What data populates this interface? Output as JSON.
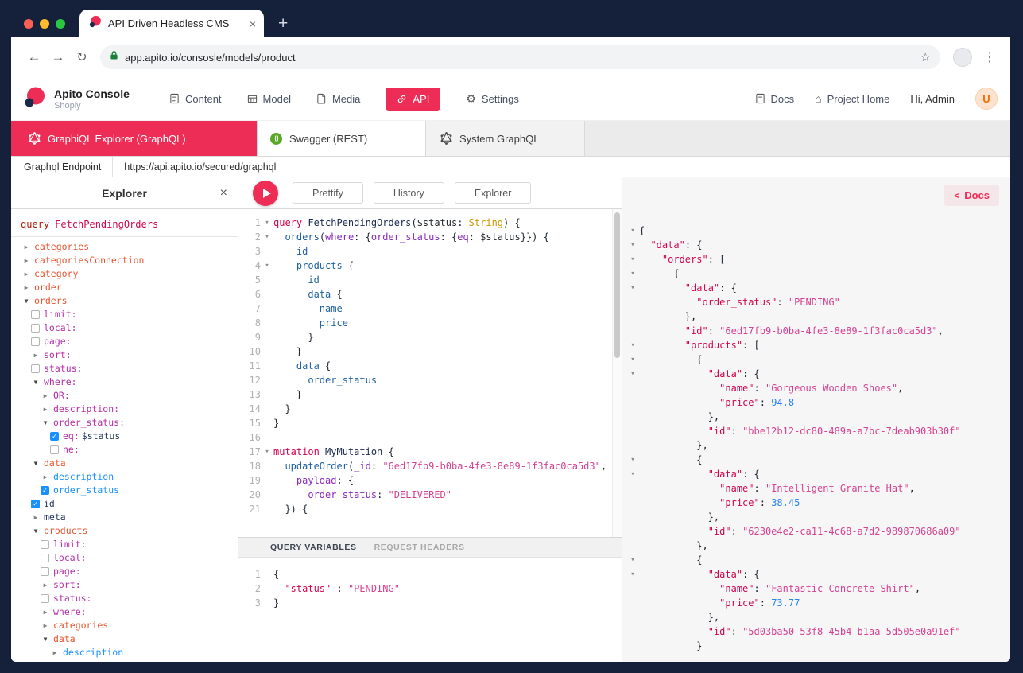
{
  "colors": {
    "accent": "#ed2d55",
    "frame": "#15213b",
    "checkbox_on": "#1890ff"
  },
  "icons": {
    "back": "←",
    "forward": "→",
    "reload": "↻",
    "bookmark": "☆",
    "menu": "⋮",
    "new_tab": "+",
    "tab_close": "×",
    "panel_close": "×",
    "gear": "⚙",
    "home": "⌂",
    "collapsed": "▶",
    "expanded": "▼",
    "checked": "✓",
    "fold": "▾"
  },
  "browser": {
    "tab_title": "API Driven Headless CMS",
    "url": "app.apito.io/consosle/models/product"
  },
  "header": {
    "brand": {
      "title": "Apito Console",
      "subtitle": "Shoply"
    },
    "nav": [
      {
        "label": "Content"
      },
      {
        "label": "Model"
      },
      {
        "label": "Media"
      },
      {
        "label": "API"
      },
      {
        "label": "Settings"
      }
    ],
    "right": {
      "docs": "Docs",
      "project_home": "Project Home",
      "greeting": "Hi, Admin",
      "avatar_initial": "U"
    }
  },
  "api_tabs": [
    {
      "label": "GraphiQL Explorer (GraphQL)",
      "active": true
    },
    {
      "label": "Swagger (REST)",
      "active": false
    },
    {
      "label": "System GraphQL",
      "active": false
    }
  ],
  "endpoint": {
    "label": "Graphql Endpoint",
    "url": "https://api.apito.io/secured/graphql"
  },
  "toolbar": {
    "prettify": "Prettify",
    "history": "History",
    "explorer": "Explorer"
  },
  "docs_button": {
    "chevron": "<",
    "label": "Docs"
  },
  "explorer_panel": {
    "title": "Explorer",
    "operation_keyword": "query",
    "operation_name": "FetchPendingOrders",
    "items": [
      {
        "indent": 0,
        "marker": "collapsed",
        "color": "field",
        "label": "categories"
      },
      {
        "indent": 0,
        "marker": "collapsed",
        "color": "field",
        "label": "categoriesConnection"
      },
      {
        "indent": 0,
        "marker": "collapsed",
        "color": "field",
        "label": "category"
      },
      {
        "indent": 0,
        "marker": "collapsed",
        "color": "field",
        "label": "order"
      },
      {
        "indent": 0,
        "marker": "expanded",
        "color": "field",
        "label": "orders"
      },
      {
        "indent": 1,
        "marker": "unchecked",
        "color": "arg",
        "label": "limit:"
      },
      {
        "indent": 1,
        "marker": "unchecked",
        "color": "arg",
        "label": "local:"
      },
      {
        "indent": 1,
        "marker": "unchecked",
        "color": "arg",
        "label": "page:"
      },
      {
        "indent": 1,
        "marker": "collapsed",
        "color": "arg",
        "label": "sort:"
      },
      {
        "indent": 1,
        "marker": "unchecked",
        "color": "arg",
        "label": "status:"
      },
      {
        "indent": 1,
        "marker": "expanded",
        "color": "arg",
        "label": "where:"
      },
      {
        "indent": 2,
        "marker": "collapsed",
        "color": "arg",
        "label": "OR:"
      },
      {
        "indent": 2,
        "marker": "collapsed",
        "color": "arg",
        "label": "description:"
      },
      {
        "indent": 2,
        "marker": "expanded",
        "color": "arg",
        "label": "order_status:"
      },
      {
        "indent": 3,
        "marker": "checked",
        "color": "arg",
        "label": "eq:",
        "suffix": "$status"
      },
      {
        "indent": 3,
        "marker": "unchecked",
        "color": "arg",
        "label": "ne:"
      },
      {
        "indent": 1,
        "marker": "expanded",
        "color": "field",
        "label": "data"
      },
      {
        "indent": 2,
        "marker": "collapsed",
        "color": "leaf",
        "label": "description"
      },
      {
        "indent": 2,
        "marker": "checked",
        "color": "leaf",
        "label": "order_status"
      },
      {
        "indent": 1,
        "marker": "checked",
        "color": "plain",
        "label": "id"
      },
      {
        "indent": 1,
        "marker": "collapsed",
        "color": "plain",
        "label": "meta"
      },
      {
        "indent": 1,
        "marker": "expanded",
        "color": "field",
        "label": "products"
      },
      {
        "indent": 2,
        "marker": "unchecked",
        "color": "arg",
        "label": "limit:"
      },
      {
        "indent": 2,
        "marker": "unchecked",
        "color": "arg",
        "label": "local:"
      },
      {
        "indent": 2,
        "marker": "unchecked",
        "color": "arg",
        "label": "page:"
      },
      {
        "indent": 2,
        "marker": "collapsed",
        "color": "arg",
        "label": "sort:"
      },
      {
        "indent": 2,
        "marker": "unchecked",
        "color": "arg",
        "label": "status:"
      },
      {
        "indent": 2,
        "marker": "collapsed",
        "color": "arg",
        "label": "where:"
      },
      {
        "indent": 2,
        "marker": "collapsed",
        "color": "field",
        "label": "categories"
      },
      {
        "indent": 2,
        "marker": "expanded",
        "color": "field",
        "label": "data"
      },
      {
        "indent": 3,
        "marker": "collapsed",
        "color": "leaf",
        "label": "description"
      }
    ]
  },
  "editor": {
    "lines": [
      {
        "n": 1,
        "f": true,
        "t": [
          [
            "kw",
            "query"
          ],
          [
            "pl",
            " "
          ],
          [
            "def",
            "FetchPendingOrders"
          ],
          [
            "pl",
            "("
          ],
          [
            "var",
            "$status"
          ],
          [
            "pl",
            ": "
          ],
          [
            "atom",
            "String"
          ],
          [
            "pl",
            ") {"
          ]
        ]
      },
      {
        "n": 2,
        "f": true,
        "t": [
          [
            "pl",
            "  "
          ],
          [
            "prop",
            "orders"
          ],
          [
            "pl",
            "("
          ],
          [
            "attr",
            "where"
          ],
          [
            "pl",
            ": {"
          ],
          [
            "attr",
            "order_status"
          ],
          [
            "pl",
            ": {"
          ],
          [
            "attr",
            "eq"
          ],
          [
            "pl",
            ": "
          ],
          [
            "var",
            "$status"
          ],
          [
            "pl",
            "}}) {"
          ]
        ]
      },
      {
        "n": 3,
        "t": [
          [
            "pl",
            "    "
          ],
          [
            "prop",
            "id"
          ]
        ]
      },
      {
        "n": 4,
        "f": true,
        "t": [
          [
            "pl",
            "    "
          ],
          [
            "prop",
            "products"
          ],
          [
            "pl",
            " {"
          ]
        ]
      },
      {
        "n": 5,
        "t": [
          [
            "pl",
            "      "
          ],
          [
            "prop",
            "id"
          ]
        ]
      },
      {
        "n": 6,
        "t": [
          [
            "pl",
            "      "
          ],
          [
            "prop",
            "data"
          ],
          [
            "pl",
            " {"
          ]
        ]
      },
      {
        "n": 7,
        "t": [
          [
            "pl",
            "        "
          ],
          [
            "prop",
            "name"
          ]
        ]
      },
      {
        "n": 8,
        "t": [
          [
            "pl",
            "        "
          ],
          [
            "prop",
            "price"
          ]
        ]
      },
      {
        "n": 9,
        "t": [
          [
            "pl",
            "      }"
          ]
        ]
      },
      {
        "n": 10,
        "t": [
          [
            "pl",
            "    }"
          ]
        ]
      },
      {
        "n": 11,
        "t": [
          [
            "pl",
            "    "
          ],
          [
            "prop",
            "data"
          ],
          [
            "pl",
            " {"
          ]
        ]
      },
      {
        "n": 12,
        "t": [
          [
            "pl",
            "      "
          ],
          [
            "prop",
            "order_status"
          ]
        ]
      },
      {
        "n": 13,
        "t": [
          [
            "pl",
            "    }"
          ]
        ]
      },
      {
        "n": 14,
        "t": [
          [
            "pl",
            "  }"
          ]
        ]
      },
      {
        "n": 15,
        "t": [
          [
            "pl",
            "}"
          ]
        ]
      },
      {
        "n": 16,
        "t": []
      },
      {
        "n": 17,
        "f": true,
        "t": [
          [
            "kw",
            "mutation"
          ],
          [
            "pl",
            " "
          ],
          [
            "def",
            "MyMutation"
          ],
          [
            "pl",
            " {"
          ]
        ]
      },
      {
        "n": 18,
        "t": [
          [
            "pl",
            "  "
          ],
          [
            "prop",
            "updateOrder"
          ],
          [
            "pl",
            "("
          ],
          [
            "attr",
            "_id"
          ],
          [
            "pl",
            ": "
          ],
          [
            "str",
            "\"6ed17fb9-b0ba-4fe3-8e89-1f3fac0ca5d3\""
          ],
          [
            "pl",
            ","
          ]
        ]
      },
      {
        "n": 19,
        "t": [
          [
            "pl",
            "    "
          ],
          [
            "attr",
            "payload"
          ],
          [
            "pl",
            ": {"
          ]
        ]
      },
      {
        "n": 20,
        "t": [
          [
            "pl",
            "      "
          ],
          [
            "attr",
            "order_status"
          ],
          [
            "pl",
            ": "
          ],
          [
            "str",
            "\"DELIVERED\""
          ]
        ]
      },
      {
        "n": 21,
        "t": [
          [
            "pl",
            "  }) {"
          ]
        ]
      }
    ]
  },
  "variables": {
    "tab_active": "QUERY VARIABLES",
    "tab_inactive": "REQUEST HEADERS",
    "lines": [
      {
        "n": 1,
        "t": [
          [
            "pl",
            "{"
          ]
        ]
      },
      {
        "n": 2,
        "t": [
          [
            "pl",
            "  "
          ],
          [
            "key",
            "\"status\""
          ],
          [
            "pl",
            " : "
          ],
          [
            "str",
            "\"PENDING\""
          ]
        ]
      },
      {
        "n": 3,
        "t": [
          [
            "pl",
            "}"
          ]
        ]
      }
    ]
  },
  "result": {
    "lines": [
      {
        "f": true,
        "t": [
          [
            "pl",
            "{"
          ]
        ]
      },
      {
        "f": true,
        "t": [
          [
            "pl",
            "  "
          ],
          [
            "key",
            "\"data\""
          ],
          [
            "pl",
            ": {"
          ]
        ]
      },
      {
        "f": true,
        "t": [
          [
            "pl",
            "    "
          ],
          [
            "key",
            "\"orders\""
          ],
          [
            "pl",
            ": ["
          ]
        ]
      },
      {
        "f": true,
        "t": [
          [
            "pl",
            "      {"
          ]
        ]
      },
      {
        "f": true,
        "t": [
          [
            "pl",
            "        "
          ],
          [
            "key",
            "\"data\""
          ],
          [
            "pl",
            ": {"
          ]
        ]
      },
      {
        "t": [
          [
            "pl",
            "          "
          ],
          [
            "key",
            "\"order_status\""
          ],
          [
            "pl",
            ": "
          ],
          [
            "str",
            "\"PENDING\""
          ]
        ]
      },
      {
        "t": [
          [
            "pl",
            "        },"
          ]
        ]
      },
      {
        "t": [
          [
            "pl",
            "        "
          ],
          [
            "key",
            "\"id\""
          ],
          [
            "pl",
            ": "
          ],
          [
            "str",
            "\"6ed17fb9-b0ba-4fe3-8e89-1f3fac0ca5d3\""
          ],
          [
            "pl",
            ","
          ]
        ]
      },
      {
        "f": true,
        "t": [
          [
            "pl",
            "        "
          ],
          [
            "key",
            "\"products\""
          ],
          [
            "pl",
            ": ["
          ]
        ]
      },
      {
        "f": true,
        "t": [
          [
            "pl",
            "          {"
          ]
        ]
      },
      {
        "f": true,
        "t": [
          [
            "pl",
            "            "
          ],
          [
            "key",
            "\"data\""
          ],
          [
            "pl",
            ": {"
          ]
        ]
      },
      {
        "t": [
          [
            "pl",
            "              "
          ],
          [
            "key",
            "\"name\""
          ],
          [
            "pl",
            ": "
          ],
          [
            "str",
            "\"Gorgeous Wooden Shoes\""
          ],
          [
            "pl",
            ","
          ]
        ]
      },
      {
        "t": [
          [
            "pl",
            "              "
          ],
          [
            "key",
            "\"price\""
          ],
          [
            "pl",
            ": "
          ],
          [
            "num",
            "94.8"
          ]
        ]
      },
      {
        "t": [
          [
            "pl",
            "            },"
          ]
        ]
      },
      {
        "t": [
          [
            "pl",
            "            "
          ],
          [
            "key",
            "\"id\""
          ],
          [
            "pl",
            ": "
          ],
          [
            "str",
            "\"bbe12b12-dc80-489a-a7bc-7deab903b30f\""
          ]
        ]
      },
      {
        "t": [
          [
            "pl",
            "          },"
          ]
        ]
      },
      {
        "f": true,
        "t": [
          [
            "pl",
            "          {"
          ]
        ]
      },
      {
        "f": true,
        "t": [
          [
            "pl",
            "            "
          ],
          [
            "key",
            "\"data\""
          ],
          [
            "pl",
            ": {"
          ]
        ]
      },
      {
        "t": [
          [
            "pl",
            "              "
          ],
          [
            "key",
            "\"name\""
          ],
          [
            "pl",
            ": "
          ],
          [
            "str",
            "\"Intelligent Granite Hat\""
          ],
          [
            "pl",
            ","
          ]
        ]
      },
      {
        "t": [
          [
            "pl",
            "              "
          ],
          [
            "key",
            "\"price\""
          ],
          [
            "pl",
            ": "
          ],
          [
            "num",
            "38.45"
          ]
        ]
      },
      {
        "t": [
          [
            "pl",
            "            },"
          ]
        ]
      },
      {
        "t": [
          [
            "pl",
            "            "
          ],
          [
            "key",
            "\"id\""
          ],
          [
            "pl",
            ": "
          ],
          [
            "str",
            "\"6230e4e2-ca11-4c68-a7d2-989870686a09\""
          ]
        ]
      },
      {
        "t": [
          [
            "pl",
            "          },"
          ]
        ]
      },
      {
        "f": true,
        "t": [
          [
            "pl",
            "          {"
          ]
        ]
      },
      {
        "f": true,
        "t": [
          [
            "pl",
            "            "
          ],
          [
            "key",
            "\"data\""
          ],
          [
            "pl",
            ": {"
          ]
        ]
      },
      {
        "t": [
          [
            "pl",
            "              "
          ],
          [
            "key",
            "\"name\""
          ],
          [
            "pl",
            ": "
          ],
          [
            "str",
            "\"Fantastic Concrete Shirt\""
          ],
          [
            "pl",
            ","
          ]
        ]
      },
      {
        "t": [
          [
            "pl",
            "              "
          ],
          [
            "key",
            "\"price\""
          ],
          [
            "pl",
            ": "
          ],
          [
            "num",
            "73.77"
          ]
        ]
      },
      {
        "t": [
          [
            "pl",
            "            },"
          ]
        ]
      },
      {
        "t": [
          [
            "pl",
            "            "
          ],
          [
            "key",
            "\"id\""
          ],
          [
            "pl",
            ": "
          ],
          [
            "str",
            "\"5d03ba50-53f8-45b4-b1aa-5d505e0a91ef\""
          ]
        ]
      },
      {
        "t": [
          [
            "pl",
            "          }"
          ]
        ]
      }
    ]
  }
}
